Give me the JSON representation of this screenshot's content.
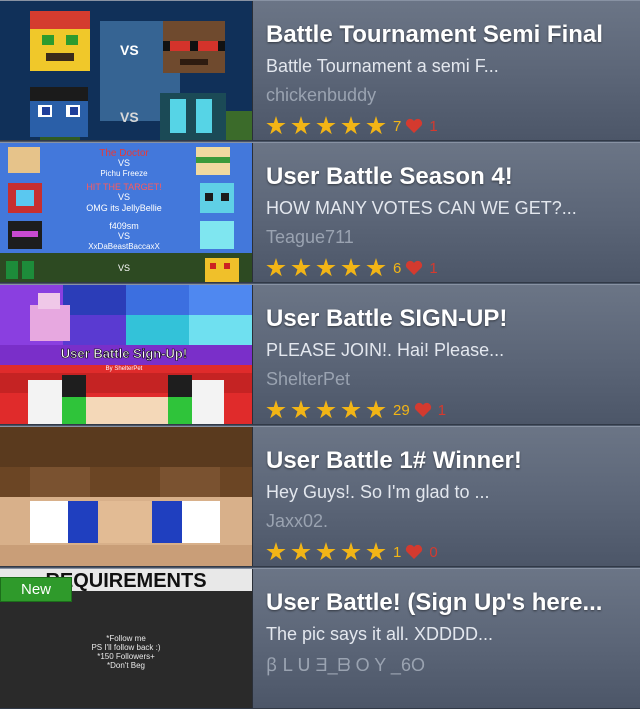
{
  "posts": [
    {
      "title": "Battle Tournament  Semi Final",
      "description": "Battle Tournament a semi F...",
      "author": "chickenbuddy",
      "stars": 5,
      "views": "7",
      "likes": "1",
      "thumbnail_text": [
        "VS",
        "VS"
      ]
    },
    {
      "title": "User Battle Season 4!",
      "description": "HOW MANY VOTES CAN WE GET?...",
      "author": "Teague711",
      "stars": 5,
      "views": "6",
      "likes": "1",
      "thumbnail_text": [
        "The Doctor",
        "VS",
        "Pichu Freeze",
        "HIT THE TARGET!",
        "VS",
        "OMG its JellyBellie",
        "f409sm",
        "VS",
        "XxDaBeastBaccaxX",
        "VS"
      ]
    },
    {
      "title": "User Battle SIGN-UP!",
      "description": "PLEASE JOIN!. Hai! Please...",
      "author": "ShelterPet",
      "stars": 5,
      "views": "29",
      "likes": "1",
      "thumbnail_text": [
        "User Battle Sign-Up!",
        "By ShelterPet"
      ]
    },
    {
      "title": "User Battle 1# Winner!",
      "description": "Hey Guys!. So I'm glad to ...",
      "author": "Jaxx02.",
      "stars": 5,
      "views": "1",
      "likes": "0",
      "thumbnail_text": []
    },
    {
      "title": "User Battle! (Sign Up's  here...",
      "description": "The pic says it all. XDDDD...",
      "author": "ꞵ ᒪ ᑌ Ǝ_ᗷ O Y _6O",
      "badge": "New",
      "thumbnail_text": [
        "REQUIREMENTS",
        "*Follow me",
        "PS I'll follow back :)",
        "*150 Followers+",
        "*Don't Beg"
      ]
    }
  ],
  "colors": {
    "star": "#f2b516",
    "heart": "#d43a2f",
    "badge": "#2f9a2b"
  }
}
